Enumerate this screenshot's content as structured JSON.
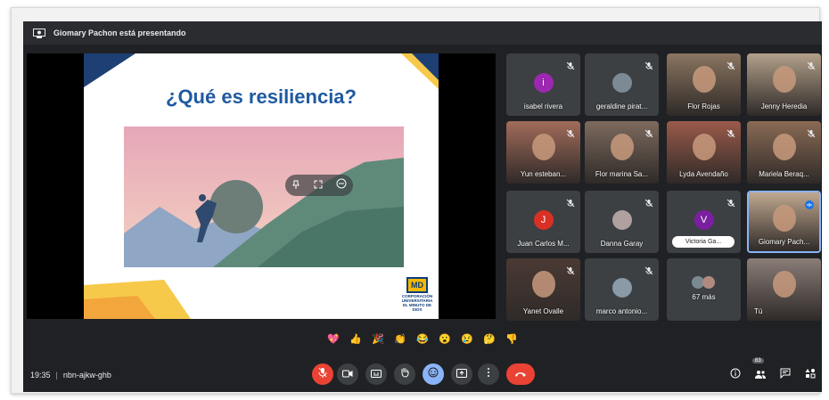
{
  "topbar": {
    "presenting_text": "Giomary Pachon está presentando"
  },
  "slide": {
    "title": "¿Qué es resiliencia?",
    "logo_mark": "MD",
    "logo_text": "CORPORACIÓN UNIVERSITARIA EL MINUTO DE DIOS"
  },
  "participants": [
    {
      "name": "isabel rivera",
      "initial": "i",
      "avatar_color": "#9c27b0"
    },
    {
      "name": "geraldine pirat...",
      "initial": "",
      "avatar_color": "#7c8a96"
    },
    {
      "name": "Flor Rojas",
      "initial": "",
      "avatar_color": ""
    },
    {
      "name": "Jenny Heredia",
      "initial": "",
      "avatar_color": ""
    },
    {
      "name": "Yun esteban...",
      "initial": "",
      "avatar_color": ""
    },
    {
      "name": "Flor marina Sa...",
      "initial": "",
      "avatar_color": ""
    },
    {
      "name": "Lyda Avendaño",
      "initial": "",
      "avatar_color": ""
    },
    {
      "name": "Mariela Beraq...",
      "initial": "",
      "avatar_color": ""
    },
    {
      "name": "Juan Carlos M...",
      "initial": "J",
      "avatar_color": "#d93025"
    },
    {
      "name": "Danna Garay",
      "initial": "",
      "avatar_color": "#b0a0a0"
    },
    {
      "name": "Victoria Ga...",
      "initial": "V",
      "avatar_color": "#7b1fa2"
    },
    {
      "name": "Giomary Pach...",
      "initial": "",
      "avatar_color": ""
    },
    {
      "name": "Yanet Ovalle",
      "initial": "",
      "avatar_color": ""
    },
    {
      "name": "marco antonio...",
      "initial": "",
      "avatar_color": "#8a9aa6"
    },
    {
      "name": "67 más",
      "initial": "",
      "avatar_color": ""
    },
    {
      "name": "Tú",
      "initial": "",
      "avatar_color": ""
    }
  ],
  "reactions": [
    "💖",
    "👍",
    "🎉",
    "👏",
    "😂",
    "😮",
    "😢",
    "🤔",
    "👎"
  ],
  "bottom": {
    "time": "19:35",
    "separator": "|",
    "meeting_code": "nbn-ajkw-ghb",
    "people_count": "83"
  },
  "colors": {
    "background": "#202124",
    "tile": "#3c4043",
    "end_call": "#ea4335",
    "mic_off": "#ea4335",
    "active": "#8ab4f8",
    "title_blue": "#1f5aa0",
    "speaking_border": "#8ab4f8"
  }
}
